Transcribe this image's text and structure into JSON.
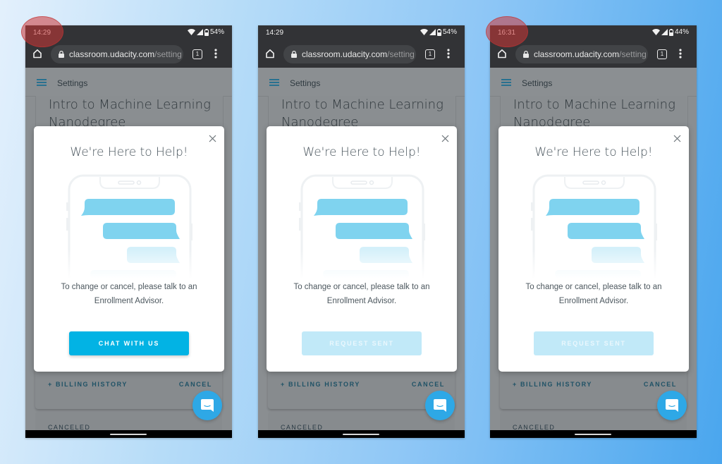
{
  "screens": [
    {
      "status": {
        "time": "14:29",
        "battery": "54%"
      },
      "browser": {
        "url_host": "classroom.udacity.com",
        "url_path": "/setting",
        "tab_count": "1"
      },
      "appbar": {
        "title": "Settings"
      },
      "course": {
        "name": "Intro to Machine Learning Nanodegree"
      },
      "billing": {
        "history_label": "+ BILLING HISTORY",
        "cancel_label": "CANCEL"
      },
      "status_card": {
        "label": "CANCELED"
      },
      "modal": {
        "title": "We're Here to Help!",
        "message_line1": "To change or cancel, please talk to an",
        "message_line2": "Enrollment Advisor.",
        "button_label": "CHAT WITH US",
        "button_state": "active"
      },
      "highlighted_time": true
    },
    {
      "status": {
        "time": "14:29",
        "battery": "54%"
      },
      "browser": {
        "url_host": "classroom.udacity.com",
        "url_path": "/setting",
        "tab_count": "1"
      },
      "appbar": {
        "title": "Settings"
      },
      "course": {
        "name": "Intro to Machine Learning Nanodegree"
      },
      "billing": {
        "history_label": "+ BILLING HISTORY",
        "cancel_label": "CANCEL"
      },
      "status_card": {
        "label": "CANCELED"
      },
      "modal": {
        "title": "We're Here to Help!",
        "message_line1": "To change or cancel, please talk to an",
        "message_line2": "Enrollment Advisor.",
        "button_label": "REQUEST SENT",
        "button_state": "disabled"
      },
      "highlighted_time": false
    },
    {
      "status": {
        "time": "16:31",
        "battery": "44%"
      },
      "browser": {
        "url_host": "classroom.udacity.com",
        "url_path": "/setting",
        "tab_count": "1"
      },
      "appbar": {
        "title": "Settings"
      },
      "course": {
        "name": "Intro to Machine Learning Nanodegree"
      },
      "billing": {
        "history_label": "+ BILLING HISTORY",
        "cancel_label": "CANCEL"
      },
      "status_card": {
        "label": "CANCELED"
      },
      "modal": {
        "title": "We're Here to Help!",
        "message_line1": "To change or cancel, please talk to an",
        "message_line2": "Enrollment Advisor.",
        "button_label": "REQUEST SENT",
        "button_state": "disabled"
      },
      "highlighted_time": true
    }
  ],
  "colors": {
    "accent": "#02b3e4",
    "accent_disabled": "#c1e9f8",
    "fab": "#2ea8e6",
    "highlight": "#cd3737",
    "chrome_bar": "#323336"
  }
}
